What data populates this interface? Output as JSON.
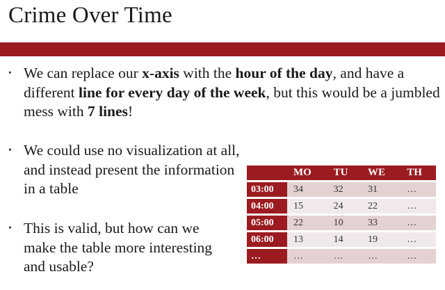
{
  "title": "Crime Over Time",
  "bullets": [
    {
      "segments": [
        {
          "text": "We can replace our ",
          "bold": false
        },
        {
          "text": "x-axis",
          "bold": true
        },
        {
          "text": " with the ",
          "bold": false
        },
        {
          "text": "hour of the day",
          "bold": true
        },
        {
          "text": ", and have a different ",
          "bold": false
        },
        {
          "text": "line for every day of the week",
          "bold": true
        },
        {
          "text": ", but this would be a jumbled mess with ",
          "bold": false
        },
        {
          "text": "7 lines",
          "bold": true
        },
        {
          "text": "!",
          "bold": false
        }
      ]
    },
    {
      "segments": [
        {
          "text": "We could use no visualization at all, and instead present the information in a table",
          "bold": false
        }
      ]
    },
    {
      "segments": [
        {
          "text": "This is valid, but how can we make the table more interesting and usable?",
          "bold": false
        }
      ]
    }
  ],
  "table": {
    "columns": [
      "MO",
      "TU",
      "WE",
      "TH"
    ],
    "rows": [
      {
        "label": "03:00",
        "cells": [
          "34",
          "32",
          "31",
          "…"
        ]
      },
      {
        "label": "04:00",
        "cells": [
          "15",
          "24",
          "22",
          "…"
        ]
      },
      {
        "label": "05:00",
        "cells": [
          "22",
          "10",
          "33",
          "…"
        ]
      },
      {
        "label": "06:00",
        "cells": [
          "13",
          "14",
          "19",
          "…"
        ]
      },
      {
        "label": "…",
        "cells": [
          "…",
          "…",
          "…",
          "…"
        ]
      }
    ]
  },
  "colors": {
    "accent": "#9b1b20",
    "row_odd": "#e4d2d2",
    "row_even": "#f1e9e9"
  }
}
